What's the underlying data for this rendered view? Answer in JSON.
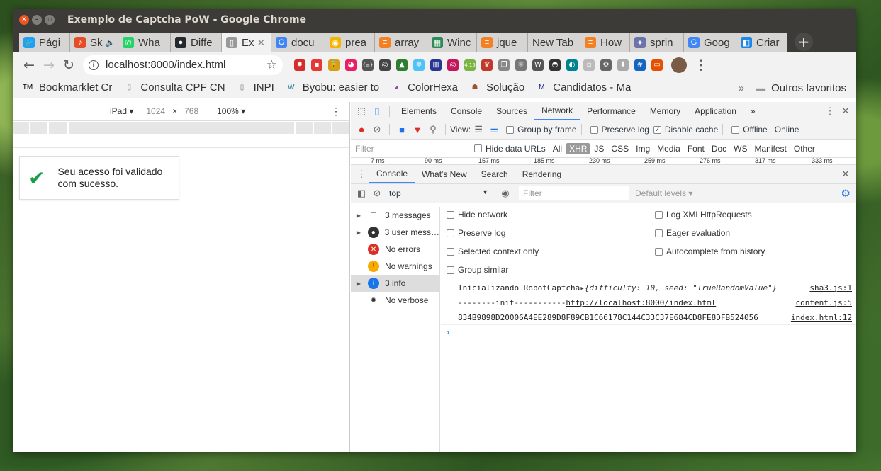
{
  "window": {
    "title": "Exemplo de Captcha PoW - Google Chrome"
  },
  "tabs": [
    {
      "label": "Pági",
      "color": "#1da1f2",
      "glyph": "🐦"
    },
    {
      "label": "Sk",
      "color": "#e44d26",
      "glyph": "♪",
      "audio": "🔈"
    },
    {
      "label": "Wha",
      "color": "#25d366",
      "glyph": "✆"
    },
    {
      "label": "Diffe",
      "color": "#24292e",
      "glyph": "●"
    },
    {
      "label": "Ex",
      "color": "#999",
      "glyph": "▯",
      "active": true
    },
    {
      "label": "docu",
      "color": "#4285f4",
      "glyph": "G"
    },
    {
      "label": "prea",
      "color": "#f4b400",
      "glyph": "◉"
    },
    {
      "label": "array",
      "color": "#f48024",
      "glyph": "≡"
    },
    {
      "label": "Winc",
      "color": "#2e8b57",
      "glyph": "▦"
    },
    {
      "label": "jque",
      "color": "#f48024",
      "glyph": "≡"
    },
    {
      "label": "New Tab",
      "color": "",
      "glyph": ""
    },
    {
      "label": "How",
      "color": "#f48024",
      "glyph": "≡"
    },
    {
      "label": "sprin",
      "color": "#6c73a8",
      "glyph": "✦"
    },
    {
      "label": "Goog",
      "color": "#4285f4",
      "glyph": "G"
    },
    {
      "label": "Criar",
      "color": "#1e88e5",
      "glyph": "◧"
    }
  ],
  "address": {
    "url": "localhost:8000/index.html"
  },
  "extensions": [
    {
      "color": "#d62c2c",
      "glyph": "✹"
    },
    {
      "color": "#e53935",
      "glyph": "▪"
    },
    {
      "color": "#d4a017",
      "glyph": "🔒"
    },
    {
      "color": "#e91e63",
      "glyph": "◕"
    },
    {
      "color": "#555",
      "glyph": "{≡}"
    },
    {
      "color": "#444",
      "glyph": "◎"
    },
    {
      "color": "#2e7d32",
      "glyph": "▲"
    },
    {
      "color": "#4fc3f7",
      "glyph": "❄"
    },
    {
      "color": "#283593",
      "glyph": "▥"
    },
    {
      "color": "#c2185b",
      "glyph": "◎"
    },
    {
      "color": "#7cb342",
      "glyph": "4,15"
    },
    {
      "color": "#c0392b",
      "glyph": "♛"
    },
    {
      "color": "#888",
      "glyph": "❐"
    },
    {
      "color": "#777",
      "glyph": "⚛"
    },
    {
      "color": "#555",
      "glyph": "W"
    },
    {
      "color": "#333",
      "glyph": "◓"
    },
    {
      "color": "#00838f",
      "glyph": "◐"
    },
    {
      "color": "#bbb",
      "glyph": "▫"
    },
    {
      "color": "#666",
      "glyph": "⚙"
    },
    {
      "color": "#aaa",
      "glyph": "⬇"
    },
    {
      "color": "#1565c0",
      "glyph": "#"
    },
    {
      "color": "#e65100",
      "glyph": "▭"
    }
  ],
  "bookmarks": [
    {
      "label": "Bookmarklet Cr",
      "icon": "TM",
      "color": "#000"
    },
    {
      "label": "Consulta CPF CN",
      "icon": "▯",
      "color": "#777"
    },
    {
      "label": "INPI",
      "icon": "▯",
      "color": "#777"
    },
    {
      "label": "Byobu: easier to",
      "icon": "W",
      "color": "#21759b"
    },
    {
      "label": "ColorHexa",
      "icon": "◕",
      "color": "#8e44ad"
    },
    {
      "label": "Solução",
      "icon": "☗",
      "color": "#a0522d"
    },
    {
      "label": "Candidatos - Ma",
      "icon": "M",
      "color": "#1a237e"
    }
  ],
  "bookmarks_more": "»",
  "other_bookmarks": "Outros favoritos",
  "device": {
    "name": "iPad ▾",
    "width": "1024",
    "x": "×",
    "height": "768",
    "zoom": "100% ▾"
  },
  "page": {
    "message": "Seu acesso foi validado com sucesso."
  },
  "devtools": {
    "tabs": [
      "Elements",
      "Console",
      "Sources",
      "Network",
      "Performance",
      "Memory",
      "Application"
    ],
    "selected": "Network",
    "more": "»",
    "net_toolbar": {
      "view": "View:",
      "group_by_frame": "Group by frame",
      "preserve_log": "Preserve log",
      "disable_cache": "Disable cache",
      "offline": "Offline",
      "online": "Online"
    },
    "filter": {
      "placeholder": "Filter",
      "hide_data_urls": "Hide data URLs",
      "types": [
        "All",
        "XHR",
        "JS",
        "CSS",
        "Img",
        "Media",
        "Font",
        "Doc",
        "WS",
        "Manifest",
        "Other"
      ],
      "selected_type": "XHR"
    },
    "timeline": [
      "7 ms",
      "90 ms",
      "157 ms",
      "185 ms",
      "230 ms",
      "259 ms",
      "276 ms",
      "317 ms",
      "333 ms"
    ],
    "drawer_tabs": [
      "Console",
      "What's New",
      "Search",
      "Rendering"
    ],
    "drawer_selected": "Console",
    "console_toolbar": {
      "context": "top",
      "filter_placeholder": "Filter",
      "levels": "Default levels ▾"
    },
    "sidebar": [
      {
        "label": "3 messages",
        "icon": "list",
        "expand": true
      },
      {
        "label": "3 user mess…",
        "icon": "user",
        "expand": true
      },
      {
        "label": "No errors",
        "icon": "error",
        "expand": false
      },
      {
        "label": "No warnings",
        "icon": "warning",
        "expand": false
      },
      {
        "label": "3 info",
        "icon": "info",
        "expand": true,
        "selected": true
      },
      {
        "label": "No verbose",
        "icon": "bug",
        "expand": false
      }
    ],
    "settings_left": [
      "Hide network",
      "Preserve log",
      "Selected context only",
      "Group similar"
    ],
    "settings_right": [
      "Log XMLHttpRequests",
      "Eager evaluation",
      "Autocomplete from history"
    ],
    "logs": [
      {
        "prefix": "Inicializando RobotCaptcha ",
        "obj": "▸{difficulty: 10, seed: \"TrueRandomValue\"}",
        "link": "",
        "source": "sha3.js:1"
      },
      {
        "prefix": "--------init----------- ",
        "obj": "",
        "link": "http://localhost:8000/index.html",
        "source": "content.js:5"
      },
      {
        "prefix": "834B9898D20006A4EE289D8F89CB1C66178C144C33C37E684CD8FE8DFB524056",
        "obj": "",
        "link": "",
        "source": "index.html:12"
      }
    ],
    "prompt": "›"
  }
}
